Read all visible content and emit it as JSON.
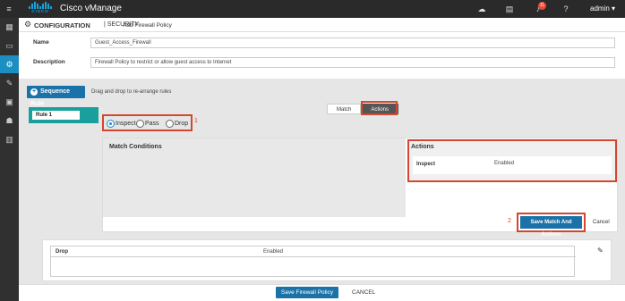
{
  "header": {
    "app_title": "Cisco vManage",
    "logo_text": "CISCO",
    "notification_count": "11",
    "user": "admin ▾",
    "icons": [
      "menu-icon",
      "cloud-icon",
      "clipboard-icon",
      "bell-icon",
      "help-icon"
    ]
  },
  "sidebar": {
    "items": [
      "dashboard-icon",
      "monitor-icon",
      "configuration-icon",
      "tools-icon",
      "maintenance-icon",
      "administration-icon",
      "analytics-icon"
    ],
    "active": "configuration-icon"
  },
  "breadcrumb": {
    "section": "CONFIGURATION",
    "separator_section": "| SECURITY",
    "page": "Add Firewall Policy"
  },
  "form": {
    "name_label": "Name",
    "name_value": "Guest_Access_Firewall",
    "description_label": "Description",
    "description_value": "Firewall Policy to restrict or allow guest access to Internet"
  },
  "sequence": {
    "button_label": "Sequence Rule",
    "hint": "Drag and drop to re-arrange rules",
    "rule_name": "Rule 1"
  },
  "tabs": [
    {
      "label": "Match",
      "active": false
    },
    {
      "label": "Actions",
      "active": true
    }
  ],
  "radios": [
    {
      "label": "Inspect",
      "selected": true
    },
    {
      "label": "Pass",
      "selected": false
    },
    {
      "label": "Drop",
      "selected": false
    }
  ],
  "callouts": {
    "one": "1",
    "two": "2"
  },
  "match_conditions": {
    "title": "Match Conditions"
  },
  "actions_panel": {
    "title": "Actions",
    "row_key": "Inspect",
    "row_value": "Enabled"
  },
  "buttons": {
    "save_match": "Save Match And Actions",
    "cancel": "Cancel",
    "save_policy": "Save Firewall Policy",
    "cancel_policy": "CANCEL"
  },
  "default_action": {
    "key": "Drop",
    "value": "Enabled"
  },
  "colors": {
    "accent": "#1b72a8",
    "highlight": "#d2472e",
    "teal": "#19a09c"
  }
}
